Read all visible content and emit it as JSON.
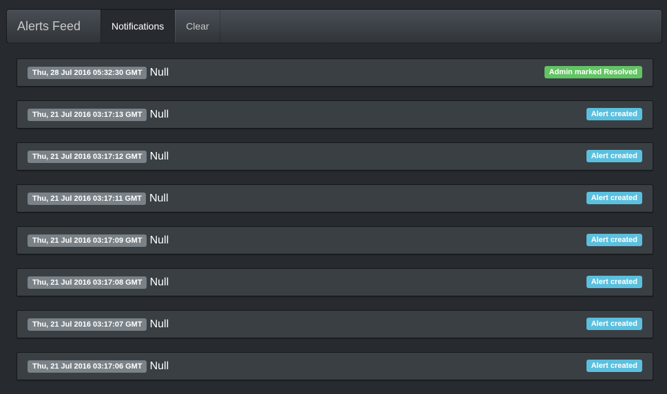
{
  "navbar": {
    "brand": "Alerts Feed",
    "items": [
      {
        "label": "Notifications",
        "active": true
      },
      {
        "label": "Clear",
        "active": false
      }
    ]
  },
  "colors": {
    "success": "#62c462",
    "info": "#5bc0de",
    "timestamp_bg": "#7a8288"
  },
  "alerts": [
    {
      "timestamp": "Thu, 28 Jul 2016 05:32:30 GMT",
      "message": "Null",
      "status": "Admin marked Resolved",
      "status_type": "success"
    },
    {
      "timestamp": "Thu, 21 Jul 2016 03:17:13 GMT",
      "message": "Null",
      "status": "Alert created",
      "status_type": "info"
    },
    {
      "timestamp": "Thu, 21 Jul 2016 03:17:12 GMT",
      "message": "Null",
      "status": "Alert created",
      "status_type": "info"
    },
    {
      "timestamp": "Thu, 21 Jul 2016 03:17:11 GMT",
      "message": "Null",
      "status": "Alert created",
      "status_type": "info"
    },
    {
      "timestamp": "Thu, 21 Jul 2016 03:17:09 GMT",
      "message": "Null",
      "status": "Alert created",
      "status_type": "info"
    },
    {
      "timestamp": "Thu, 21 Jul 2016 03:17:08 GMT",
      "message": "Null",
      "status": "Alert created",
      "status_type": "info"
    },
    {
      "timestamp": "Thu, 21 Jul 2016 03:17:07 GMT",
      "message": "Null",
      "status": "Alert created",
      "status_type": "info"
    },
    {
      "timestamp": "Thu, 21 Jul 2016 03:17:06 GMT",
      "message": "Null",
      "status": "Alert created",
      "status_type": "info"
    }
  ]
}
